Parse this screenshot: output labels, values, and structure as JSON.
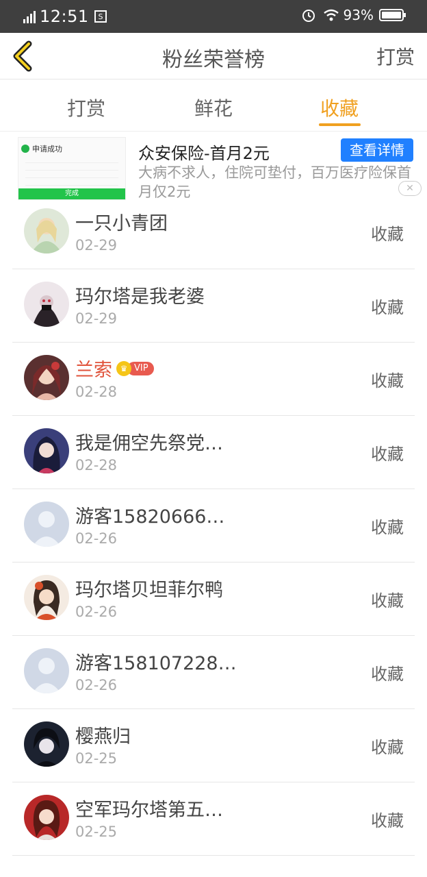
{
  "status_bar": {
    "time": "12:51",
    "network": "G",
    "battery": "93%"
  },
  "header": {
    "title": "粉丝荣誉榜",
    "right_action": "打赏"
  },
  "tabs": [
    {
      "label": "打赏",
      "active": false
    },
    {
      "label": "鲜花",
      "active": false
    },
    {
      "label": "收藏",
      "active": true
    }
  ],
  "ad": {
    "thumb_status": "申请成功",
    "thumb_button": "完成",
    "title": "众安保险-首月2元",
    "description": "大病不求人，住院可垫付，百万医疗险保首月仅2元",
    "cta": "查看详情"
  },
  "vip_label": "VIP",
  "fans": [
    {
      "name": "一只小青团",
      "date": "02-29",
      "action": "收藏",
      "vip": false
    },
    {
      "name": "玛尔塔是我老婆",
      "date": "02-29",
      "action": "收藏",
      "vip": false
    },
    {
      "name": "兰索",
      "date": "02-28",
      "action": "收藏",
      "vip": true
    },
    {
      "name": "我是佣空先祭党…",
      "date": "02-28",
      "action": "收藏",
      "vip": false
    },
    {
      "name": "游客15820666…",
      "date": "02-26",
      "action": "收藏",
      "vip": false
    },
    {
      "name": "玛尔塔贝坦菲尔鸭",
      "date": "02-26",
      "action": "收藏",
      "vip": false
    },
    {
      "name": "游客158107228…",
      "date": "02-26",
      "action": "收藏",
      "vip": false
    },
    {
      "name": "樱燕归",
      "date": "02-25",
      "action": "收藏",
      "vip": false
    },
    {
      "name": "空军玛尔塔第五…",
      "date": "02-25",
      "action": "收藏",
      "vip": false
    }
  ],
  "colors": {
    "accent": "#f0a020",
    "vip_name": "#e0523a",
    "ad_button": "#2080ff"
  }
}
